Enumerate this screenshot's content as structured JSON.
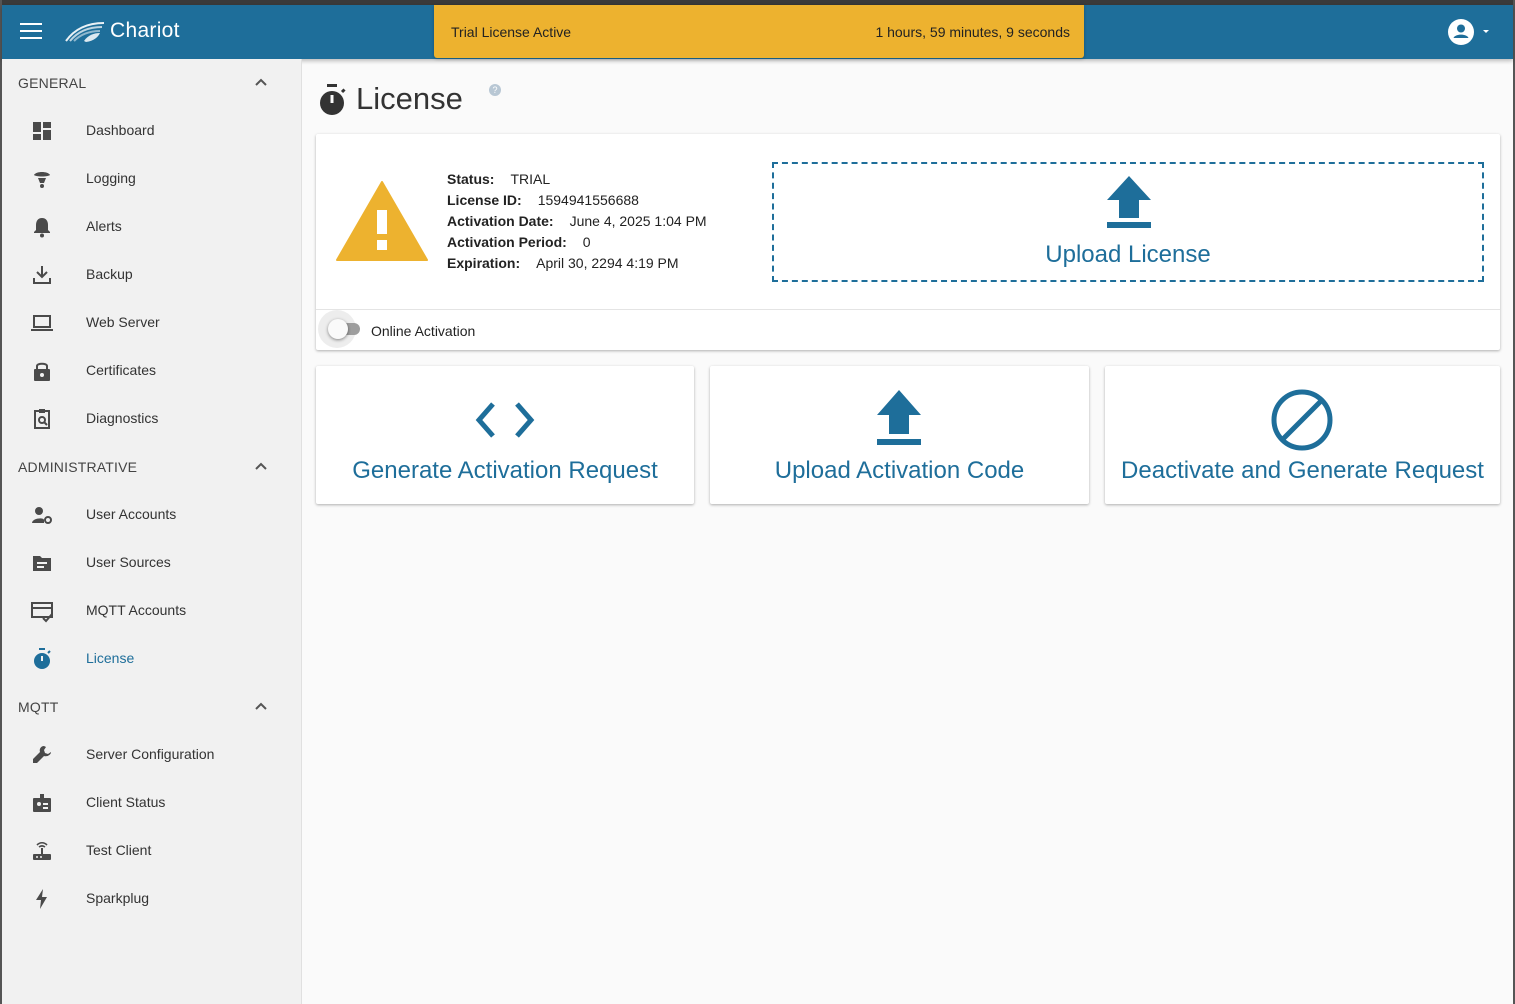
{
  "app": {
    "title": "Chariot",
    "brand_color": "#1e6e9a",
    "banner_color": "#edb22f"
  },
  "banner": {
    "text": "Trial License Active",
    "timer": "1 hours, 59 minutes, 9 seconds"
  },
  "sidebar": {
    "sections": [
      {
        "title": "GENERAL",
        "items": [
          {
            "label": "Dashboard",
            "icon": "dashboard-icon"
          },
          {
            "label": "Logging",
            "icon": "logging-icon"
          },
          {
            "label": "Alerts",
            "icon": "bell-icon"
          },
          {
            "label": "Backup",
            "icon": "download-icon"
          },
          {
            "label": "Web Server",
            "icon": "laptop-icon"
          },
          {
            "label": "Certificates",
            "icon": "lock-icon"
          },
          {
            "label": "Diagnostics",
            "icon": "clipboard-search-icon"
          }
        ]
      },
      {
        "title": "ADMINISTRATIVE",
        "items": [
          {
            "label": "User Accounts",
            "icon": "user-gear-icon"
          },
          {
            "label": "User Sources",
            "icon": "folder-icon"
          },
          {
            "label": "MQTT Accounts",
            "icon": "card-check-icon"
          },
          {
            "label": "License",
            "icon": "timer-icon",
            "active": true
          }
        ]
      },
      {
        "title": "MQTT",
        "items": [
          {
            "label": "Server Configuration",
            "icon": "wrench-icon"
          },
          {
            "label": "Client Status",
            "icon": "badge-icon"
          },
          {
            "label": "Test Client",
            "icon": "router-icon"
          },
          {
            "label": "Sparkplug",
            "icon": "bolt-icon"
          }
        ]
      }
    ]
  },
  "page": {
    "title": "License"
  },
  "license": {
    "status_label": "Status:",
    "status_value": "TRIAL",
    "id_label": "License ID:",
    "id_value": "1594941556688",
    "activation_date_label": "Activation Date:",
    "activation_date_value": "June 4, 2025 1:04 PM",
    "activation_period_label": "Activation Period:",
    "activation_period_value": "0",
    "expiration_label": "Expiration:",
    "expiration_value": "April 30, 2294 4:19 PM",
    "upload_label": "Upload License",
    "online_activation_label": "Online Activation",
    "online_activation_on": false
  },
  "actions": {
    "generate": "Generate Activation Request",
    "upload_code": "Upload Activation Code",
    "deactivate": "Deactivate and Generate Request"
  }
}
